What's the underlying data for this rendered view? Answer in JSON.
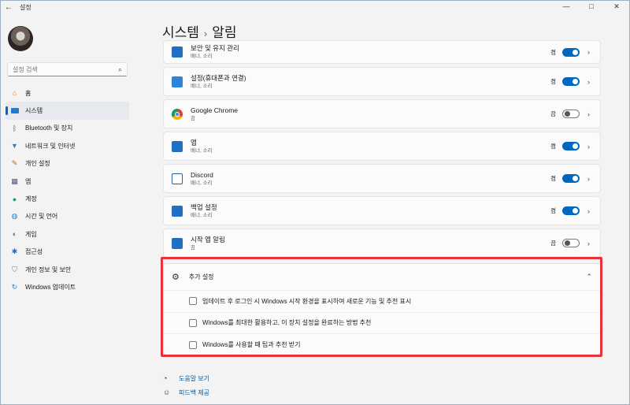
{
  "window": {
    "title": "설정",
    "back_icon": "back-arrow-icon",
    "minimize": "—",
    "maximize": "□",
    "close": "✕"
  },
  "sidebar": {
    "search_placeholder": "설정 검색",
    "items": [
      {
        "label": "홈",
        "icon": "home-icon"
      },
      {
        "label": "시스템",
        "icon": "system-icon",
        "active": true
      },
      {
        "label": "Bluetooth 및 장치",
        "icon": "bluetooth-icon"
      },
      {
        "label": "네트워크 및 인터넷",
        "icon": "wifi-icon"
      },
      {
        "label": "개인 설정",
        "icon": "brush-icon"
      },
      {
        "label": "앱",
        "icon": "apps-icon"
      },
      {
        "label": "계정",
        "icon": "account-icon"
      },
      {
        "label": "시간 및 언어",
        "icon": "globe-icon"
      },
      {
        "label": "게임",
        "icon": "gamepad-icon"
      },
      {
        "label": "접근성",
        "icon": "accessibility-icon"
      },
      {
        "label": "개인 정보 및 보안",
        "icon": "shield-icon"
      },
      {
        "label": "Windows 업데이트",
        "icon": "update-icon"
      }
    ]
  },
  "breadcrumb": {
    "parent": "시스템",
    "separator": "›",
    "current": "알림"
  },
  "apps": [
    {
      "name": "보안 및 유지 관리",
      "sub": "배너, 소리",
      "state": "켬",
      "on": true
    },
    {
      "name": "설정(휴대폰과 연결)",
      "sub": "배너, 소리",
      "state": "켬",
      "on": true
    },
    {
      "name": "Google Chrome",
      "sub": "끔",
      "state": "끔",
      "on": false
    },
    {
      "name": "앱",
      "sub": "배너, 소리",
      "state": "켬",
      "on": true
    },
    {
      "name": "Discord",
      "sub": "배너, 소리",
      "state": "켬",
      "on": true
    },
    {
      "name": "백업 설정",
      "sub": "배너, 소리",
      "state": "켬",
      "on": true
    },
    {
      "name": "시작 앱 알림",
      "sub": "끔",
      "state": "끔",
      "on": false
    }
  ],
  "extra": {
    "title": "추가 설정",
    "options": [
      "업데이트 후 로그인 시 Windows 시작 환경을 표시하여 새로운 기능 및 추천 표시",
      "Windows를 최대한 활용하고, 이 장치 설정을 완료하는 방법 추천",
      "Windows를 사용할 때 팁과 추천 받기"
    ]
  },
  "links": {
    "help": "도움말 보기",
    "feedback": "피드백 제공"
  },
  "colors": {
    "accent": "#0067c0",
    "highlight": "#e8323a"
  }
}
